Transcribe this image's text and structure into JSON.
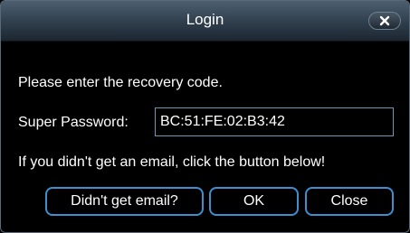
{
  "dialog": {
    "title": "Login",
    "close_icon": "close-x-icon"
  },
  "main": {
    "prompt": "Please enter the recovery code.",
    "password_label": "Super Password:",
    "password_value": "BC:51:FE:02:B3:42",
    "hint": "If you didn't get an email, click the button below!"
  },
  "buttons": {
    "email_label": "Didn't get email?",
    "ok_label": "OK",
    "close_label": "Close"
  },
  "colors": {
    "titlebar": "#2f3e4c",
    "button_border": "#3f8fcf",
    "input_border": "#6d97b5",
    "background": "#000000",
    "text": "#ffffff"
  }
}
